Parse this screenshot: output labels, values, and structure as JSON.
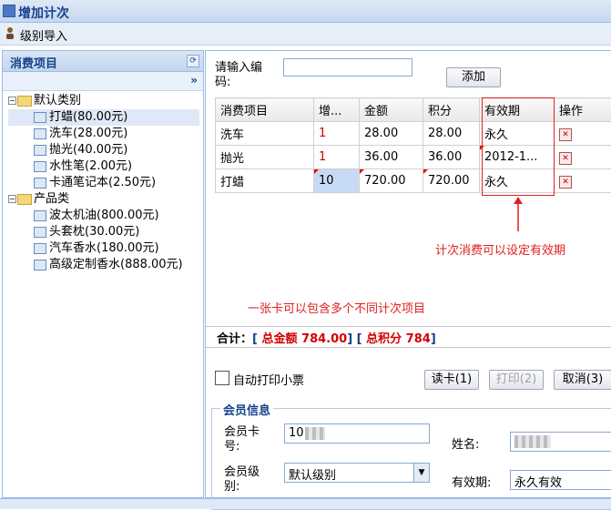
{
  "window": {
    "title": "增加计次"
  },
  "toolbar": {
    "level_import": "级别导入"
  },
  "left_panel": {
    "title": "消费项目",
    "collapse_glyph": "»",
    "categories": [
      {
        "name": "默认类别",
        "items": [
          "打蜡(80.00元)",
          "洗车(28.00元)",
          "抛光(40.00元)",
          "水性笔(2.00元)",
          "卡通笔记本(2.50元)"
        ]
      },
      {
        "name": "产品类",
        "items": [
          "波太机油(800.00元)",
          "头套枕(30.00元)",
          "汽车香水(180.00元)",
          "高级定制香水(888.00元)"
        ]
      }
    ]
  },
  "search": {
    "label": "请输入编码:",
    "label_line1": "请输入编",
    "label_line2": "码:",
    "value": "",
    "add_button": "添加"
  },
  "grid": {
    "headers": [
      "消费项目",
      "增...",
      "金额",
      "积分",
      "有效期",
      "操作"
    ],
    "rows": [
      {
        "item": "洗车",
        "count": "1",
        "amount": "28.00",
        "points": "28.00",
        "validity": "永久"
      },
      {
        "item": "抛光",
        "count": "1",
        "amount": "36.00",
        "points": "36.00",
        "validity": "2012-1..."
      },
      {
        "item": "打蜡",
        "count": "10",
        "amount": "720.00",
        "points": "720.00",
        "validity": "永久"
      }
    ]
  },
  "annotations": {
    "validity_note": "计次消费可以设定有效期",
    "multi_item_note": "一张卡可以包含多个不同计次项目"
  },
  "summary": {
    "prefix": "合计：",
    "amount_label": "总金额 784.00",
    "points_label": "总积分 784"
  },
  "actions": {
    "auto_print": "自动打印小票",
    "auto_print_checked": false,
    "read_card": "读卡(1)",
    "print": "打印(2)",
    "cancel": "取消(3)"
  },
  "member": {
    "legend": "会员信息",
    "card_label_line1": "会员卡",
    "card_label_line2": "号:",
    "card_value": "10",
    "name_label": "姓名:",
    "level_label_line1": "会员级",
    "level_label_line2": "别:",
    "level_value": "默认级别",
    "validity_label": "有效期:",
    "validity_value": "永久有效"
  },
  "colors": {
    "accent": "#15428b",
    "annotation": "#e01f1f",
    "highlight_box": "#e02020"
  }
}
